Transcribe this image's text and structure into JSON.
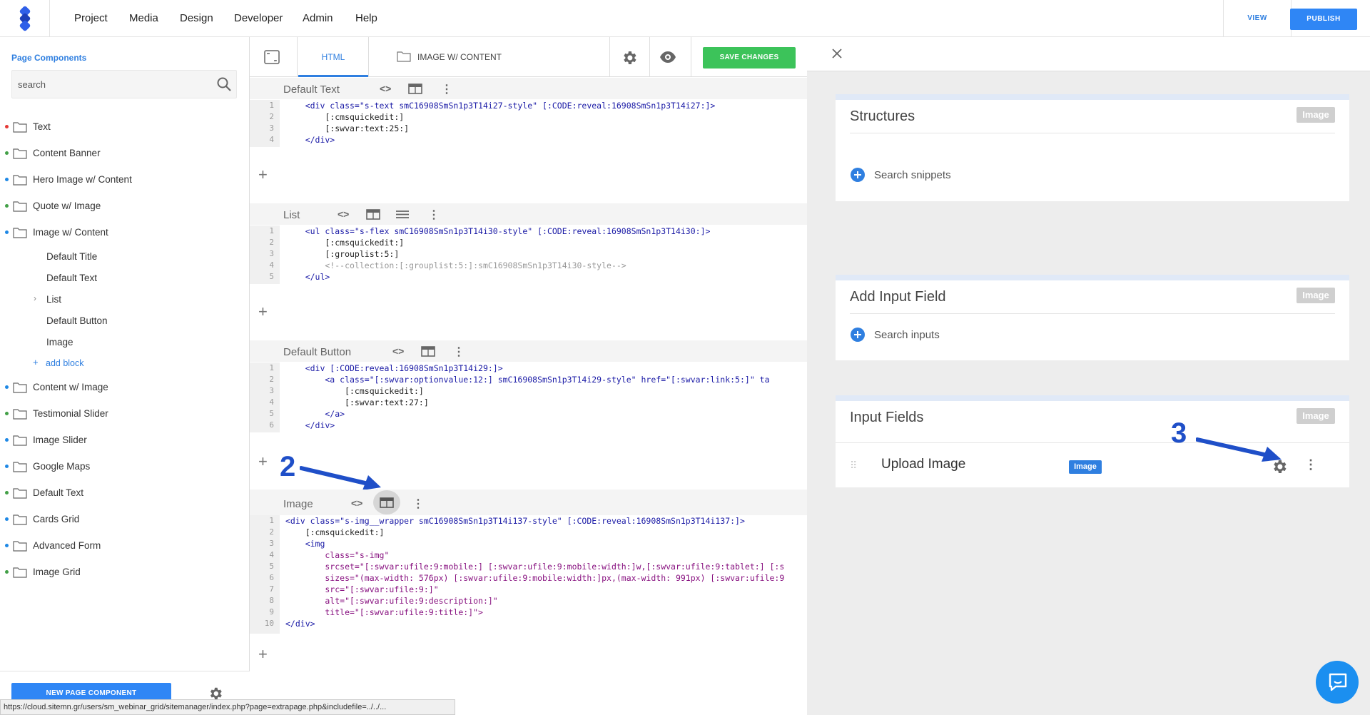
{
  "topnav": {
    "items": [
      "Project",
      "Media",
      "Design",
      "Developer",
      "Admin",
      "Help"
    ],
    "view_label": "VIEW",
    "publish_label": "PUBLISH"
  },
  "sidebar": {
    "title": "Page Components",
    "search_placeholder": "search",
    "items": [
      {
        "label": "Text",
        "dot": "#e53935"
      },
      {
        "label": "Content Banner",
        "dot": "#43a047"
      },
      {
        "label": "Hero Image w/ Content",
        "dot": "#1e88e5"
      },
      {
        "label": "Quote w/ Image",
        "dot": "#43a047"
      },
      {
        "label": "Image w/ Content",
        "dot": "#1e88e5"
      }
    ],
    "subitems": [
      "Default Title",
      "Default Text",
      "List",
      "Default Button",
      "Image"
    ],
    "add_block": "add block",
    "items_after": [
      {
        "label": "Content w/ Image",
        "dot": "#1e88e5"
      },
      {
        "label": "Testimonial Slider",
        "dot": "#43a047"
      },
      {
        "label": "Image Slider",
        "dot": "#1e88e5"
      },
      {
        "label": "Google Maps",
        "dot": "#1e88e5"
      },
      {
        "label": "Default Text",
        "dot": "#43a047"
      },
      {
        "label": "Cards Grid",
        "dot": "#1e88e5"
      },
      {
        "label": "Advanced Form",
        "dot": "#1e88e5"
      },
      {
        "label": "Image Grid",
        "dot": "#43a047"
      }
    ],
    "new_component_label": "NEW PAGE COMPONENT"
  },
  "editor": {
    "tab_html": "HTML",
    "tab_image_content": "IMAGE W/ CONTENT",
    "save_label": "SAVE CHANGES",
    "blocks": [
      {
        "title": "Default Text",
        "lines": [
          "    <div class=\"s-text smC16908SmSn1p3T14i27-style\" [:CODE:reveal:16908SmSn1p3T14i27:]>",
          "        [:cmsquickedit:]",
          "        [:swvar:text:25:]",
          "    </div>"
        ]
      },
      {
        "title": "List",
        "lines": [
          "    <ul class=\"s-flex smC16908SmSn1p3T14i30-style\" [:CODE:reveal:16908SmSn1p3T14i30:]>",
          "        [:cmsquickedit:]",
          "        [:grouplist:5:]",
          "        <!--collection:[:grouplist:5:]:smC16908SmSn1p3T14i30-style-->",
          "    </ul>"
        ]
      },
      {
        "title": "Default Button",
        "lines": [
          "    <div [:CODE:reveal:16908SmSn1p3T14i29:]>",
          "        <a class=\"[:swvar:optionvalue:12:] smC16908SmSn1p3T14i29-style\" href=\"[:swvar:link:5:]\" ta",
          "            [:cmsquickedit:]",
          "            [:swvar:text:27:]",
          "        </a>",
          "    </div>"
        ]
      },
      {
        "title": "Image",
        "lines": [
          "<div class=\"s-img__wrapper smC16908SmSn1p3T14i137-style\" [:CODE:reveal:16908SmSn1p3T14i137:]>",
          "    [:cmsquickedit:]",
          "    <img",
          "        class=\"s-img\"",
          "        srcset=\"[:swvar:ufile:9:mobile:] [:swvar:ufile:9:mobile:width:]w,[:swvar:ufile:9:tablet:] [:s",
          "        sizes=\"(max-width: 576px) [:swvar:ufile:9:mobile:width:]px,(max-width: 991px) [:swvar:ufile:9",
          "        src=\"[:swvar:ufile:9:]\"",
          "        alt=\"[:swvar:ufile:9:description:]\"",
          "        title=\"[:swvar:ufile:9:title:]\">",
          "</div>"
        ]
      }
    ]
  },
  "rightpanel": {
    "cards": [
      {
        "title": "Structures",
        "badge": "Image",
        "link": "Search snippets"
      },
      {
        "title": "Add Input Field",
        "badge": "Image",
        "link": "Search inputs"
      },
      {
        "title": "Input Fields",
        "badge": "Image",
        "field_label": "Upload Image",
        "field_badge": "Image"
      }
    ]
  },
  "annotations": [
    "2",
    "3"
  ],
  "status_url": "https://cloud.sitemn.gr/users/sm_webinar_grid/sitemanager/index.php?page=extrapage.php&includefile=../../...",
  "colors": {
    "accent": "#2f7fe0",
    "save": "#3cc35a",
    "annotation": "#1f4fc8"
  }
}
